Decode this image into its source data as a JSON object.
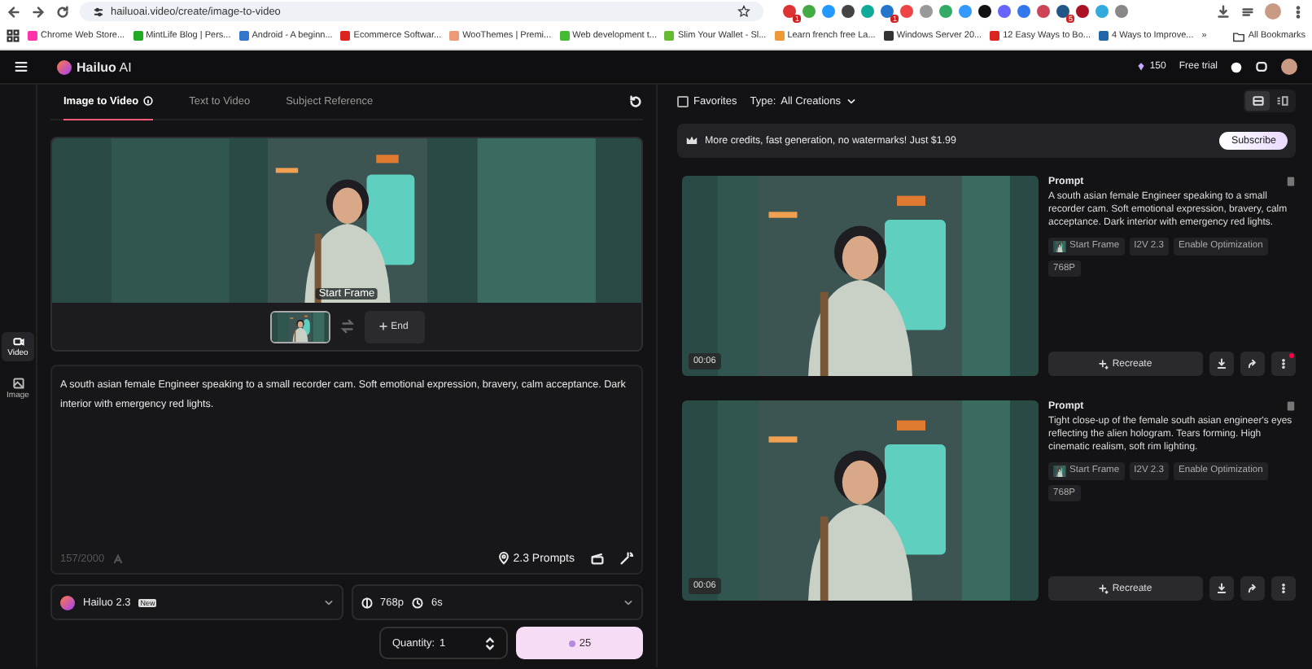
{
  "browser": {
    "url": "hailuoai.video/create/image-to-video",
    "extensions": [
      {
        "kind": "badge",
        "badge": "1"
      },
      {
        "kind": "plain"
      },
      {
        "kind": "plain"
      },
      {
        "kind": "plain"
      },
      {
        "kind": "plain"
      },
      {
        "kind": "badge",
        "badge": "1"
      },
      {
        "kind": "plain"
      },
      {
        "kind": "plain"
      },
      {
        "kind": "plain"
      },
      {
        "kind": "plain"
      },
      {
        "kind": "plain"
      },
      {
        "kind": "plain"
      },
      {
        "kind": "plain"
      },
      {
        "kind": "plain"
      },
      {
        "kind": "badge",
        "badge": "5"
      },
      {
        "kind": "plain"
      },
      {
        "kind": "plain"
      },
      {
        "kind": "plain"
      }
    ],
    "bookmarks": [
      "Chrome Web Store...",
      "MintLife Blog | Pers...",
      "Android - A beginn...",
      "Ecommerce Softwar...",
      "WooThemes | Premi...",
      "Web development t...",
      "Slim Your Wallet - Sl...",
      "Learn french free La...",
      "Windows Server 20...",
      "12 Easy Ways to Bo...",
      "4 Ways to Improve..."
    ],
    "overflow": "»",
    "all_bookmarks": "All Bookmarks"
  },
  "header": {
    "brand": "**Hailuo** AI",
    "credits": "150",
    "trial": "Free trial"
  },
  "sidebar": [
    {
      "label": "Video",
      "selected": true
    },
    {
      "label": "Image",
      "selected": false
    }
  ],
  "tabs": [
    {
      "label": "Image to Video",
      "selected": true
    },
    {
      "label": "Text to Video",
      "selected": false
    },
    {
      "label": "Subject Reference",
      "selected": false
    }
  ],
  "preview": {
    "start_label": "Start Frame",
    "end_label": "End"
  },
  "prompt": {
    "value": "A south asian female Engineer speaking to a small recorder cam. Soft emotional expression, bravery, calm acceptance. Dark interior with emergency red lights.",
    "counter": "157/2000",
    "prompts_label": "2.3 Prompts"
  },
  "model": {
    "name": "Hailuo 2.3",
    "badge": "New"
  },
  "settings": {
    "resolution": "768p",
    "duration": "6s"
  },
  "quantity": {
    "label": "Quantity:",
    "value": "1"
  },
  "generate": {
    "cost": "25"
  },
  "filters": {
    "favorites": {
      "label": "Favorites",
      "checked": false
    },
    "type_label": "Type:",
    "type_value": "All Creations"
  },
  "views": [
    {
      "selected": true
    },
    {
      "selected": false
    }
  ],
  "banner": {
    "text": "More credits, fast generation, no watermarks! Just $1.99",
    "button": "Subscribe"
  },
  "results": [
    {
      "duration": "00:06",
      "title": "Prompt",
      "prompt": "A south asian female Engineer speaking to a small recorder cam. Soft emotional expression, bravery, calm acceptance. Dark interior with emergency red lights.",
      "tags": [
        {
          "kind": "frame",
          "label": "Start Frame"
        },
        {
          "kind": "text",
          "label": "I2V 2.3"
        },
        {
          "kind": "text",
          "label": "Enable Optimization"
        },
        {
          "kind": "text",
          "label": "768P"
        }
      ],
      "recreate": "Recreate",
      "notice": true
    },
    {
      "duration": "00:06",
      "title": "Prompt",
      "prompt": "Tight close-up of the female south asian engineer's eyes reflecting the alien hologram. Tears forming. High cinematic realism, soft rim lighting.",
      "tags": [
        {
          "kind": "frame",
          "label": "Start Frame"
        },
        {
          "kind": "text",
          "label": "I2V 2.3"
        },
        {
          "kind": "text",
          "label": "Enable Optimization"
        },
        {
          "kind": "text",
          "label": "768P"
        }
      ],
      "recreate": "Recreate",
      "notice": false
    }
  ]
}
